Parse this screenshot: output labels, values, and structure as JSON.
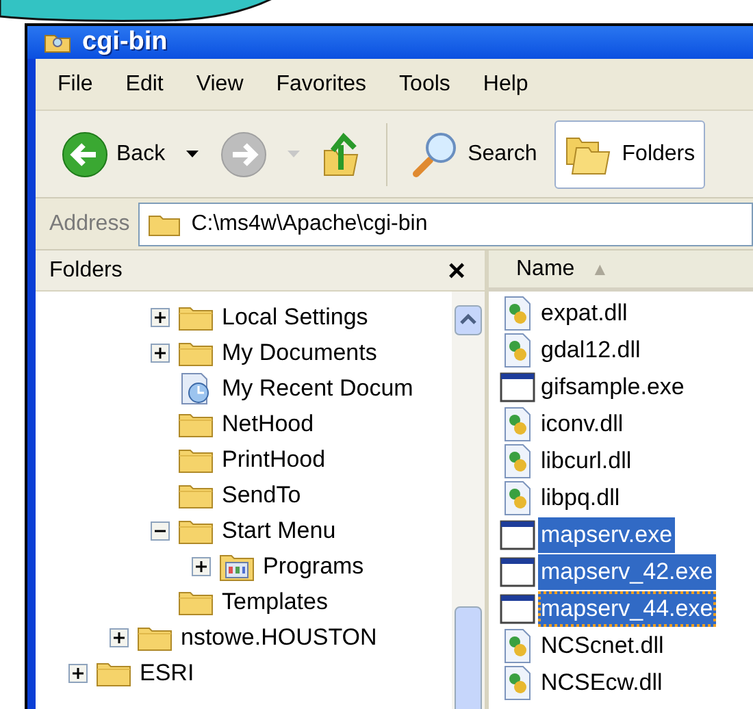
{
  "window": {
    "title": "cgi-bin"
  },
  "menu": [
    "File",
    "Edit",
    "View",
    "Favorites",
    "Tools",
    "Help"
  ],
  "toolbar": [
    {
      "kind": "back",
      "label": "Back",
      "disabled": false,
      "selected": false
    },
    {
      "kind": "forward",
      "disabled": true,
      "selected": false
    },
    {
      "kind": "up",
      "selected": false
    },
    {
      "kind": "search",
      "label": "Search",
      "disabled": false,
      "selected": false
    },
    {
      "kind": "folders",
      "label": "Folders",
      "disabled": false,
      "selected": true
    }
  ],
  "address": {
    "label": "Address",
    "value": "C:\\ms4w\\Apache\\cgi-bin"
  },
  "folders_pane": {
    "title": "Folders",
    "close": "×",
    "tree": [
      {
        "children": [
          {
            "children": [
              {
                "label": "Local Settings",
                "kind": "folder",
                "expanded": false
              },
              {
                "label": "My Documents",
                "kind": "folder",
                "expanded": false
              },
              {
                "label": "My Recent Docum",
                "kind": "recent"
              },
              {
                "label": "NetHood",
                "kind": "folder"
              },
              {
                "label": "PrintHood",
                "kind": "folder"
              },
              {
                "label": "SendTo",
                "kind": "folder"
              },
              {
                "label": "Start Menu",
                "kind": "folder",
                "expanded": true,
                "children": [
                  {
                    "label": "Programs",
                    "kind": "programs",
                    "expanded": false
                  }
                ]
              },
              {
                "label": "Templates",
                "kind": "folder"
              }
            ]
          },
          {
            "label": "nstowe.HOUSTON",
            "kind": "folder",
            "expanded": false
          }
        ]
      },
      {
        "label": "ESRI",
        "kind": "folder",
        "expanded": false
      }
    ]
  },
  "files": {
    "column": "Name",
    "sort": "▲",
    "items": [
      {
        "name": "expat.dll",
        "kind": "dll",
        "selected": false,
        "focused": false
      },
      {
        "name": "gdal12.dll",
        "kind": "dll",
        "selected": false,
        "focused": false
      },
      {
        "name": "gifsample.exe",
        "kind": "exe",
        "selected": false,
        "focused": false
      },
      {
        "name": "iconv.dll",
        "kind": "dll",
        "selected": false,
        "focused": false
      },
      {
        "name": "libcurl.dll",
        "kind": "dll",
        "selected": false,
        "focused": false
      },
      {
        "name": "libpq.dll",
        "kind": "dll",
        "selected": false,
        "focused": false
      },
      {
        "name": "mapserv.exe",
        "kind": "exe",
        "selected": true,
        "focused": false
      },
      {
        "name": "mapserv_42.exe",
        "kind": "exe",
        "selected": true,
        "focused": false
      },
      {
        "name": "mapserv_44.exe",
        "kind": "exe",
        "selected": true,
        "focused": true
      },
      {
        "name": "NCScnet.dll",
        "kind": "dll",
        "selected": false,
        "focused": false
      },
      {
        "name": "NCSEcw.dll",
        "kind": "dll",
        "selected": false,
        "focused": false
      }
    ]
  }
}
